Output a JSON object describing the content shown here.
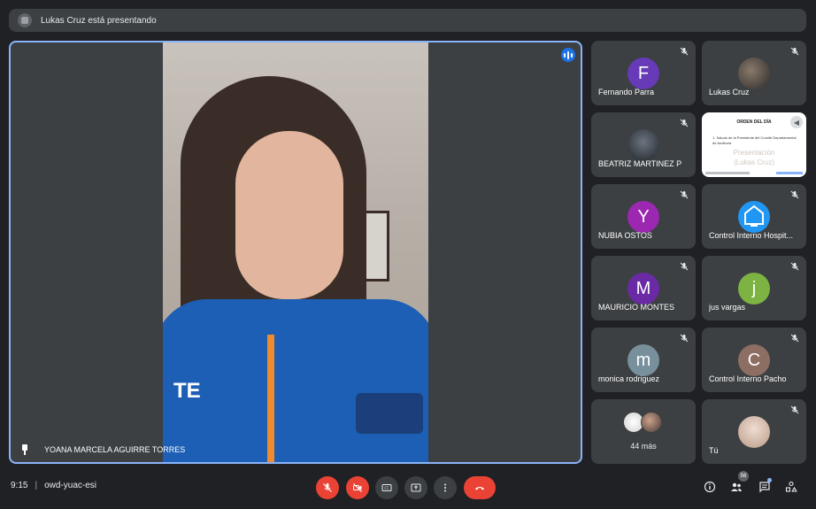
{
  "banner": {
    "text": "Lukas Cruz está presentando"
  },
  "main": {
    "participant_name": "YOANA MARCELA AGUIRRE TORRES",
    "jacket_text": "TE"
  },
  "tiles": [
    {
      "name": "Fernando Parra",
      "initial": "F",
      "color": "#673ab7",
      "muted": true
    },
    {
      "name": "Lukas Cruz",
      "initial": "",
      "color": "",
      "muted": true
    },
    {
      "name": "BEATRIZ MARTINEZ P",
      "initial": "",
      "color": "",
      "muted": true
    },
    {
      "name": "",
      "initial": "",
      "color": "",
      "muted": false
    },
    {
      "name": "NUBIA OSTOS",
      "initial": "Y",
      "color": "#9c27b0",
      "muted": true
    },
    {
      "name": "Control Interno Hospit...",
      "initial": "",
      "color": "#2196f3",
      "muted": true
    },
    {
      "name": "MAURICIO MONTES",
      "initial": "M",
      "color": "#6a2aa5",
      "muted": true
    },
    {
      "name": "jus vargas",
      "initial": "j",
      "color": "#7cb342",
      "muted": true
    },
    {
      "name": "monica rodriguez",
      "initial": "m",
      "color": "#78909c",
      "muted": true
    },
    {
      "name": "Control Interno Pacho",
      "initial": "C",
      "color": "#8d6e63",
      "muted": true
    },
    {
      "name": "",
      "initial": "",
      "color": "",
      "muted": false
    },
    {
      "name": "Tú",
      "initial": "",
      "color": "",
      "muted": true
    }
  ],
  "slide": {
    "title": "ORDEN DEL DÍA",
    "line": "1. Saludo de la Presidente del Comité Departamental de Auditoría",
    "big_line1": "Presentación",
    "big_line2": "(Lukas Cruz)"
  },
  "more": {
    "label": "44 más"
  },
  "bottombar": {
    "time": "9:15",
    "separator": "|",
    "meeting_code": "owd-yuac-esi",
    "people_count": "56"
  },
  "colors": {
    "background": "#202124",
    "tile": "#3c4043",
    "accent": "#8ab4f8",
    "danger": "#ea4335"
  }
}
